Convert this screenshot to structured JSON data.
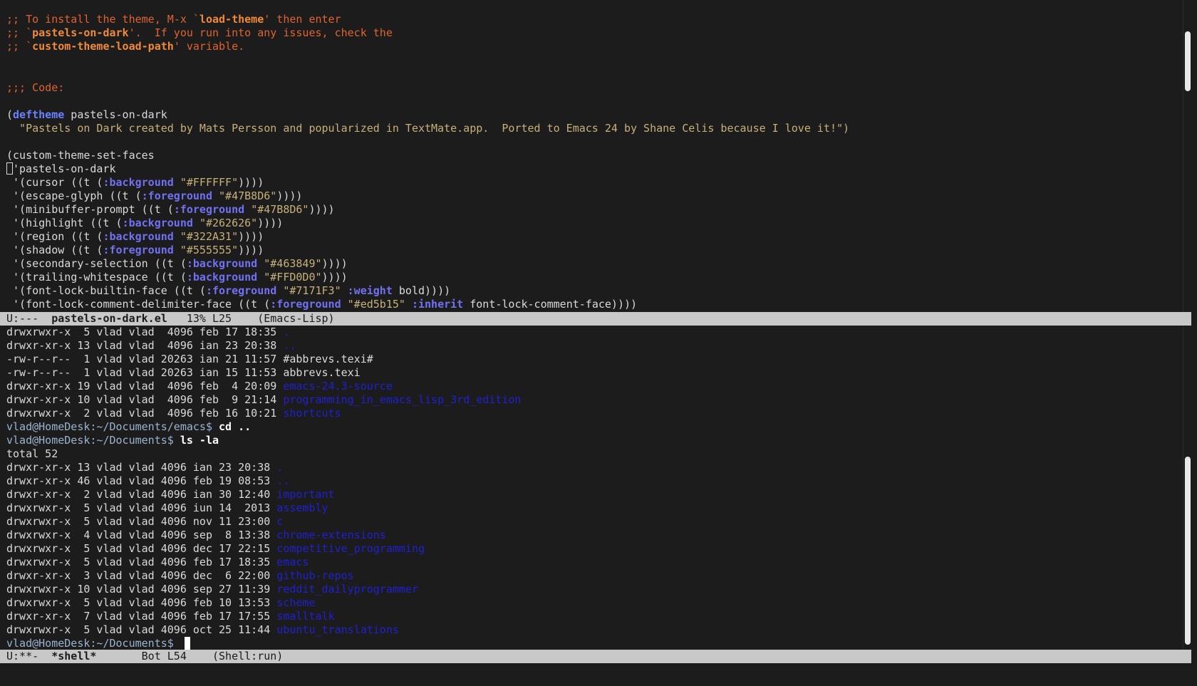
{
  "top_buffer": {
    "comment_lines": [
      {
        "pre": ";; To install the theme, M-x `",
        "b": "load-theme",
        "post": "' then enter"
      },
      {
        "pre": ";; `",
        "b": "pastels-on-dark",
        "post": "'.  If you run into any issues, check the"
      },
      {
        "pre": ";; `",
        "b": "custom-theme-load-path",
        "post": "' variable."
      }
    ],
    "code_header": ";;; Code:",
    "deftheme_keyword": "deftheme",
    "deftheme_name": " pastels-on-dark",
    "docstring": "  \"Pastels on Dark created by Mats Persson and popularized in TextMate.app.  Ported to Emacs 24 by Shane Celis because I love it!\")",
    "set_faces": "(custom-theme-set-faces",
    "theme_symbol": "'pastels-on-dark",
    "faces": [
      {
        "name": " '(cursor ((t (",
        "key": ":background",
        "val": "\"#FFFFFF\"",
        "tail": "))))"
      },
      {
        "name": " '(escape-glyph ((t (",
        "key": ":foreground",
        "val": "\"#47B8D6\"",
        "tail": "))))"
      },
      {
        "name": " '(minibuffer-prompt ((t (",
        "key": ":foreground",
        "val": "\"#47B8D6\"",
        "tail": "))))"
      },
      {
        "name": " '(highlight ((t (",
        "key": ":background",
        "val": "\"#262626\"",
        "tail": "))))"
      },
      {
        "name": " '(region ((t (",
        "key": ":background",
        "val": "\"#322A31\"",
        "tail": "))))"
      },
      {
        "name": " '(shadow ((t (",
        "key": ":foreground",
        "val": "\"#555555\"",
        "tail": "))))"
      },
      {
        "name": " '(secondary-selection ((t (",
        "key": ":background",
        "val": "\"#463849\"",
        "tail": "))))"
      },
      {
        "name": " '(trailing-whitespace ((t (",
        "key": ":background",
        "val": "\"#FFD0D0\"",
        "tail": "))))"
      }
    ],
    "builtin_face": {
      "name": " '(font-lock-builtin-face ((t (",
      "key": ":foreground",
      "val": "\"#7171F3\"",
      "key2": ":weight",
      "rest": " bold))))"
    },
    "comment_delim_face": {
      "name": " '(font-lock-comment-delimiter-face ((t (",
      "key": ":foreground",
      "val": "\"#ed5b15\"",
      "key2": ":inherit",
      "rest": " font-lock-comment-face))))"
    }
  },
  "top_modeline": {
    "status": "U:---  ",
    "buffer": "pastels-on-dark.el",
    "info": "   13% L25    (Emacs-Lisp)"
  },
  "bottom_buffer": {
    "listing1": [
      {
        "meta": "drwxrwxr-x  5 vlad vlad  4096 feb 17 18:35 ",
        "name": ".",
        "dir": true
      },
      {
        "meta": "drwxr-xr-x 13 vlad vlad  4096 ian 23 20:38 ",
        "name": "..",
        "dir": true
      },
      {
        "meta": "-rw-r--r--  1 vlad vlad 20263 ian 21 11:57 ",
        "name": "#abbrevs.texi#",
        "dir": false
      },
      {
        "meta": "-rw-r--r--  1 vlad vlad 20263 ian 15 11:53 ",
        "name": "abbrevs.texi",
        "dir": false
      },
      {
        "meta": "drwxr-xr-x 19 vlad vlad  4096 feb  4 20:09 ",
        "name": "emacs-24.3-source",
        "dir": true
      },
      {
        "meta": "drwxr-xr-x 10 vlad vlad  4096 feb  9 21:14 ",
        "name": "programming_in_emacs_lisp_3rd_edition",
        "dir": true
      },
      {
        "meta": "drwxrwxr-x  2 vlad vlad  4096 feb 16 10:21 ",
        "name": "shortcuts",
        "dir": true
      }
    ],
    "prompt1": "vlad@HomeDesk:~/Documents/emacs$ ",
    "cmd1": "cd ..",
    "prompt2": "vlad@HomeDesk:~/Documents$ ",
    "cmd2": "ls -la",
    "total": "total 52",
    "listing2": [
      {
        "meta": "drwxr-xr-x 13 vlad vlad 4096 ian 23 20:38 ",
        "name": "."
      },
      {
        "meta": "drwxr-xr-x 46 vlad vlad 4096 feb 19 08:53 ",
        "name": ".."
      },
      {
        "meta": "drwxr-xr-x  2 vlad vlad 4096 ian 30 12:40 ",
        "name": "important"
      },
      {
        "meta": "drwxrwxr-x  5 vlad vlad 4096 iun 14  2013 ",
        "name": "assembly"
      },
      {
        "meta": "drwxrwxr-x  5 vlad vlad 4096 nov 11 23:00 ",
        "name": "c"
      },
      {
        "meta": "drwxrwxr-x  4 vlad vlad 4096 sep  8 13:38 ",
        "name": "chrome-extensions"
      },
      {
        "meta": "drwxrwxr-x  5 vlad vlad 4096 dec 17 22:15 ",
        "name": "competitive_programming"
      },
      {
        "meta": "drwxrwxr-x  5 vlad vlad 4096 feb 17 18:35 ",
        "name": "emacs"
      },
      {
        "meta": "drwxr-xr-x  3 vlad vlad 4096 dec  6 22:00 ",
        "name": "github-repos"
      },
      {
        "meta": "drwxrwxr-x 10 vlad vlad 4096 sep 27 11:39 ",
        "name": "reddit_dailyprogrammer"
      },
      {
        "meta": "drwxrwxr-x  5 vlad vlad 4096 feb 10 13:53 ",
        "name": "scheme"
      },
      {
        "meta": "drwxr-xr-x  7 vlad vlad 4096 feb 17 17:55 ",
        "name": "smalltalk"
      },
      {
        "meta": "drwxrwxr-x  5 vlad vlad 4096 oct 25 11:44 ",
        "name": "ubuntu_translations"
      }
    ],
    "prompt3": "vlad@HomeDesk:~/Documents$ "
  },
  "bottom_modeline": {
    "status": "U:**-  ",
    "buffer": "*shell*",
    "info": "       Bot L54    (Shell:run)"
  }
}
